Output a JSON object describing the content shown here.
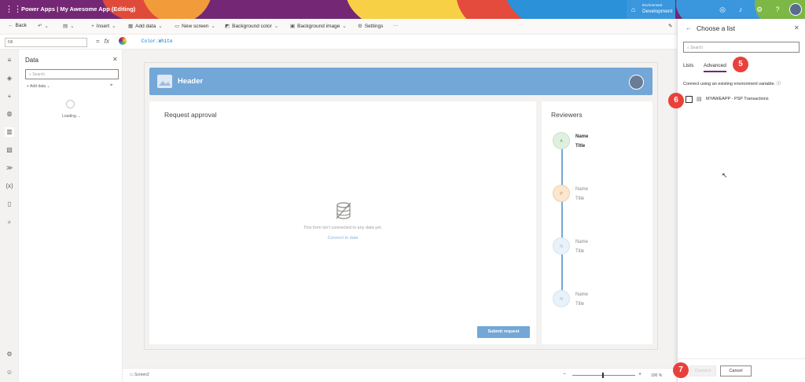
{
  "topbar": {
    "brand": "Power Apps  |  My Awesome App (Editing)",
    "env_label": "Environment",
    "env_value": "Development",
    "accent": "#742774"
  },
  "toolbar": {
    "back": "Back",
    "insert": "Insert",
    "add_data": "Add data",
    "new_screen": "New screen",
    "background_color": "Background color",
    "background_image": "Background image",
    "settings": "Settings",
    "more": "···"
  },
  "formula": {
    "property": "Fill",
    "fx": "fx",
    "value": "Color.White"
  },
  "data_pane": {
    "title": "Data",
    "search_placeholder": "Search",
    "add_data": "Add data",
    "loading": "Loading ..."
  },
  "app": {
    "header": "Header",
    "request_title": "Request approval",
    "empty_message": "This form isn't connected to any data yet.",
    "connect_link": "Connect to data",
    "submit": "Submit request",
    "reviewers_title": "Reviewers",
    "reviewers": [
      {
        "initial": "A",
        "name": "Name",
        "title": "Title",
        "color": "#dff0e0",
        "text": "#6a9a6c"
      },
      {
        "initial": "P",
        "name": "Name",
        "title": "Title",
        "color": "#fbe6cf",
        "text": "#c0884a"
      },
      {
        "initial": "N",
        "name": "Name",
        "title": "Title",
        "color": "#e9f1f9",
        "text": "#9ab1c9"
      },
      {
        "initial": "N",
        "name": "Name",
        "title": "Title",
        "color": "#e9f1f9",
        "text": "#9ab1c9"
      }
    ]
  },
  "statusbar": {
    "screen": "Screen2",
    "zoom": "100 %"
  },
  "right_panel": {
    "title": "Choose a list",
    "search_placeholder": "Search",
    "tab_lists": "Lists",
    "tab_advanced": "Advanced",
    "info": "Connect using an existing environment variable.",
    "item": "MYAWEAPP - PSP Transactions",
    "connect": "Connect",
    "cancel": "Cancel"
  },
  "markers": [
    "5",
    "6",
    "7"
  ]
}
